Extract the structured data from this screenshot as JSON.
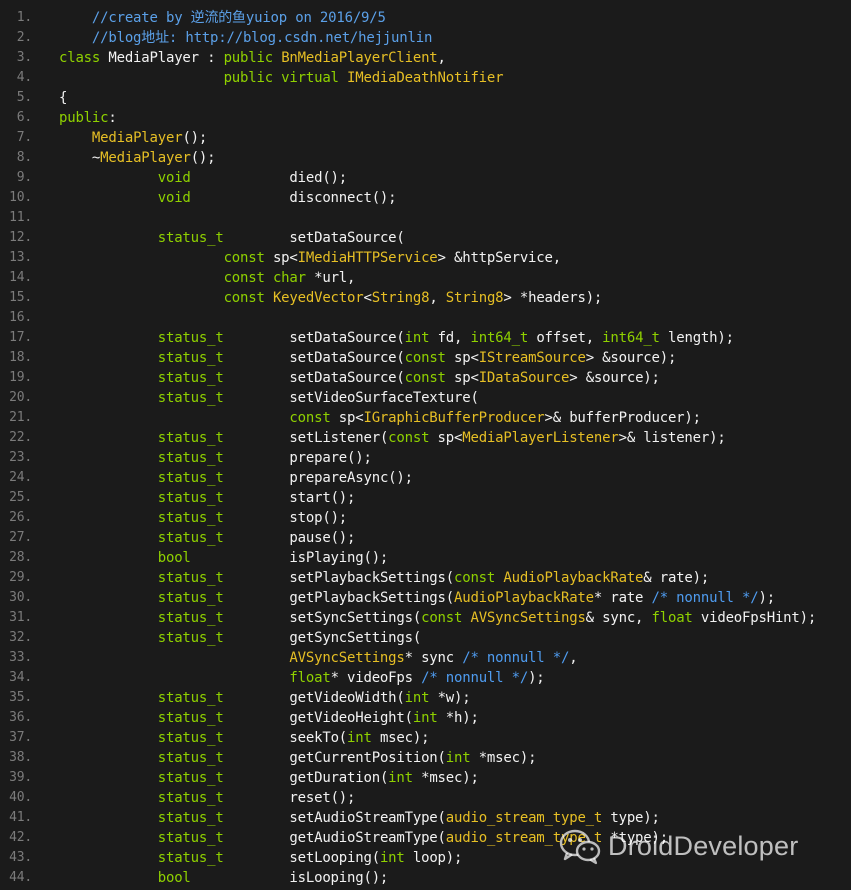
{
  "editor": {
    "lines": [
      {
        "n": "1.",
        "tokens": [
          [
            "c",
            "    //create by 逆流的鱼yuiop on 2016/9/5"
          ]
        ]
      },
      {
        "n": "2.",
        "tokens": [
          [
            "c",
            "    //blog地址: http://blog.csdn.net/hejjunlin"
          ]
        ]
      },
      {
        "n": "3.",
        "tokens": [
          [
            "k",
            "class "
          ],
          [
            "p",
            "MediaPlayer : "
          ],
          [
            "k",
            "public "
          ],
          [
            "y",
            "BnMediaPlayerClient"
          ],
          [
            "p",
            ","
          ]
        ]
      },
      {
        "n": "4.",
        "tokens": [
          [
            "p",
            "                    "
          ],
          [
            "k",
            "public virtual "
          ],
          [
            "y",
            "IMediaDeathNotifier"
          ]
        ]
      },
      {
        "n": "5.",
        "tokens": [
          [
            "p",
            "{"
          ]
        ]
      },
      {
        "n": "6.",
        "tokens": [
          [
            "k",
            "public"
          ],
          [
            "p",
            ":"
          ]
        ]
      },
      {
        "n": "7.",
        "tokens": [
          [
            "p",
            "    "
          ],
          [
            "y",
            "MediaPlayer"
          ],
          [
            "p",
            "();"
          ]
        ]
      },
      {
        "n": "8.",
        "tokens": [
          [
            "p",
            "    ~"
          ],
          [
            "y",
            "MediaPlayer"
          ],
          [
            "p",
            "();"
          ]
        ]
      },
      {
        "n": "9.",
        "tokens": [
          [
            "p",
            "            "
          ],
          [
            "k",
            "void"
          ],
          [
            "p",
            "            died();"
          ]
        ]
      },
      {
        "n": "10.",
        "tokens": [
          [
            "p",
            "            "
          ],
          [
            "k",
            "void"
          ],
          [
            "p",
            "            disconnect();"
          ]
        ]
      },
      {
        "n": "11.",
        "tokens": [
          [
            "p",
            ""
          ]
        ]
      },
      {
        "n": "12.",
        "tokens": [
          [
            "p",
            "            "
          ],
          [
            "k",
            "status_t"
          ],
          [
            "p",
            "        setDataSource("
          ]
        ]
      },
      {
        "n": "13.",
        "tokens": [
          [
            "p",
            "                    "
          ],
          [
            "k",
            "const "
          ],
          [
            "p",
            "sp<"
          ],
          [
            "y",
            "IMediaHTTPService"
          ],
          [
            "p",
            "> &httpService,"
          ]
        ]
      },
      {
        "n": "14.",
        "tokens": [
          [
            "p",
            "                    "
          ],
          [
            "k",
            "const char "
          ],
          [
            "p",
            "*url,"
          ]
        ]
      },
      {
        "n": "15.",
        "tokens": [
          [
            "p",
            "                    "
          ],
          [
            "k",
            "const "
          ],
          [
            "y",
            "KeyedVector"
          ],
          [
            "p",
            "<"
          ],
          [
            "y",
            "String8"
          ],
          [
            "p",
            ", "
          ],
          [
            "y",
            "String8"
          ],
          [
            "p",
            "> *headers);"
          ]
        ]
      },
      {
        "n": "16.",
        "tokens": [
          [
            "p",
            ""
          ]
        ]
      },
      {
        "n": "17.",
        "tokens": [
          [
            "p",
            "            "
          ],
          [
            "k",
            "status_t"
          ],
          [
            "p",
            "        setDataSource("
          ],
          [
            "k",
            "int "
          ],
          [
            "p",
            "fd, "
          ],
          [
            "k",
            "int64_t "
          ],
          [
            "p",
            "offset, "
          ],
          [
            "k",
            "int64_t "
          ],
          [
            "p",
            "length);"
          ]
        ]
      },
      {
        "n": "18.",
        "tokens": [
          [
            "p",
            "            "
          ],
          [
            "k",
            "status_t"
          ],
          [
            "p",
            "        setDataSource("
          ],
          [
            "k",
            "const "
          ],
          [
            "p",
            "sp<"
          ],
          [
            "y",
            "IStreamSource"
          ],
          [
            "p",
            "> &source);"
          ]
        ]
      },
      {
        "n": "19.",
        "tokens": [
          [
            "p",
            "            "
          ],
          [
            "k",
            "status_t"
          ],
          [
            "p",
            "        setDataSource("
          ],
          [
            "k",
            "const "
          ],
          [
            "p",
            "sp<"
          ],
          [
            "y",
            "IDataSource"
          ],
          [
            "p",
            "> &source);"
          ]
        ]
      },
      {
        "n": "20.",
        "tokens": [
          [
            "p",
            "            "
          ],
          [
            "k",
            "status_t"
          ],
          [
            "p",
            "        setVideoSurfaceTexture("
          ]
        ]
      },
      {
        "n": "21.",
        "tokens": [
          [
            "p",
            "                            "
          ],
          [
            "k",
            "const "
          ],
          [
            "p",
            "sp<"
          ],
          [
            "y",
            "IGraphicBufferProducer"
          ],
          [
            "p",
            ">& bufferProducer);"
          ]
        ]
      },
      {
        "n": "22.",
        "tokens": [
          [
            "p",
            "            "
          ],
          [
            "k",
            "status_t"
          ],
          [
            "p",
            "        setListener("
          ],
          [
            "k",
            "const "
          ],
          [
            "p",
            "sp<"
          ],
          [
            "y",
            "MediaPlayerListener"
          ],
          [
            "p",
            ">& listener);"
          ]
        ]
      },
      {
        "n": "23.",
        "tokens": [
          [
            "p",
            "            "
          ],
          [
            "k",
            "status_t"
          ],
          [
            "p",
            "        prepare();"
          ]
        ]
      },
      {
        "n": "24.",
        "tokens": [
          [
            "p",
            "            "
          ],
          [
            "k",
            "status_t"
          ],
          [
            "p",
            "        prepareAsync();"
          ]
        ]
      },
      {
        "n": "25.",
        "tokens": [
          [
            "p",
            "            "
          ],
          [
            "k",
            "status_t"
          ],
          [
            "p",
            "        start();"
          ]
        ]
      },
      {
        "n": "26.",
        "tokens": [
          [
            "p",
            "            "
          ],
          [
            "k",
            "status_t"
          ],
          [
            "p",
            "        stop();"
          ]
        ]
      },
      {
        "n": "27.",
        "tokens": [
          [
            "p",
            "            "
          ],
          [
            "k",
            "status_t"
          ],
          [
            "p",
            "        pause();"
          ]
        ]
      },
      {
        "n": "28.",
        "tokens": [
          [
            "p",
            "            "
          ],
          [
            "k",
            "bool"
          ],
          [
            "p",
            "            isPlaying();"
          ]
        ]
      },
      {
        "n": "29.",
        "tokens": [
          [
            "p",
            "            "
          ],
          [
            "k",
            "status_t"
          ],
          [
            "p",
            "        setPlaybackSettings("
          ],
          [
            "k",
            "const "
          ],
          [
            "y",
            "AudioPlaybackRate"
          ],
          [
            "p",
            "& rate);"
          ]
        ]
      },
      {
        "n": "30.",
        "tokens": [
          [
            "p",
            "            "
          ],
          [
            "k",
            "status_t"
          ],
          [
            "p",
            "        getPlaybackSettings("
          ],
          [
            "y",
            "AudioPlaybackRate"
          ],
          [
            "p",
            "* rate "
          ],
          [
            "cc",
            "/* nonnull */"
          ],
          [
            "p",
            ");"
          ]
        ]
      },
      {
        "n": "31.",
        "tokens": [
          [
            "p",
            "            "
          ],
          [
            "k",
            "status_t"
          ],
          [
            "p",
            "        setSyncSettings("
          ],
          [
            "k",
            "const "
          ],
          [
            "y",
            "AVSyncSettings"
          ],
          [
            "p",
            "& sync, "
          ],
          [
            "k",
            "float "
          ],
          [
            "p",
            "videoFpsHint);"
          ]
        ]
      },
      {
        "n": "32.",
        "tokens": [
          [
            "p",
            "            "
          ],
          [
            "k",
            "status_t"
          ],
          [
            "p",
            "        getSyncSettings("
          ]
        ]
      },
      {
        "n": "33.",
        "tokens": [
          [
            "p",
            "                            "
          ],
          [
            "y",
            "AVSyncSettings"
          ],
          [
            "p",
            "* sync "
          ],
          [
            "cc",
            "/* nonnull */"
          ],
          [
            "p",
            ","
          ]
        ]
      },
      {
        "n": "34.",
        "tokens": [
          [
            "p",
            "                            "
          ],
          [
            "k",
            "float"
          ],
          [
            "p",
            "* videoFps "
          ],
          [
            "cc",
            "/* nonnull */"
          ],
          [
            "p",
            ");"
          ]
        ]
      },
      {
        "n": "35.",
        "tokens": [
          [
            "p",
            "            "
          ],
          [
            "k",
            "status_t"
          ],
          [
            "p",
            "        getVideoWidth("
          ],
          [
            "k",
            "int "
          ],
          [
            "p",
            "*w);"
          ]
        ]
      },
      {
        "n": "36.",
        "tokens": [
          [
            "p",
            "            "
          ],
          [
            "k",
            "status_t"
          ],
          [
            "p",
            "        getVideoHeight("
          ],
          [
            "k",
            "int "
          ],
          [
            "p",
            "*h);"
          ]
        ]
      },
      {
        "n": "37.",
        "tokens": [
          [
            "p",
            "            "
          ],
          [
            "k",
            "status_t"
          ],
          [
            "p",
            "        seekTo("
          ],
          [
            "k",
            "int "
          ],
          [
            "p",
            "msec);"
          ]
        ]
      },
      {
        "n": "38.",
        "tokens": [
          [
            "p",
            "            "
          ],
          [
            "k",
            "status_t"
          ],
          [
            "p",
            "        getCurrentPosition("
          ],
          [
            "k",
            "int "
          ],
          [
            "p",
            "*msec);"
          ]
        ]
      },
      {
        "n": "39.",
        "tokens": [
          [
            "p",
            "            "
          ],
          [
            "k",
            "status_t"
          ],
          [
            "p",
            "        getDuration("
          ],
          [
            "k",
            "int "
          ],
          [
            "p",
            "*msec);"
          ]
        ]
      },
      {
        "n": "40.",
        "tokens": [
          [
            "p",
            "            "
          ],
          [
            "k",
            "status_t"
          ],
          [
            "p",
            "        reset();"
          ]
        ]
      },
      {
        "n": "41.",
        "tokens": [
          [
            "p",
            "            "
          ],
          [
            "k",
            "status_t"
          ],
          [
            "p",
            "        setAudioStreamType("
          ],
          [
            "y",
            "audio_stream_type_t "
          ],
          [
            "p",
            "type);"
          ]
        ]
      },
      {
        "n": "42.",
        "tokens": [
          [
            "p",
            "            "
          ],
          [
            "k",
            "status_t"
          ],
          [
            "p",
            "        getAudioStreamType("
          ],
          [
            "y",
            "audio_stream_type_t "
          ],
          [
            "p",
            "*type);"
          ]
        ]
      },
      {
        "n": "43.",
        "tokens": [
          [
            "p",
            "            "
          ],
          [
            "k",
            "status_t"
          ],
          [
            "p",
            "        setLooping("
          ],
          [
            "k",
            "int "
          ],
          [
            "p",
            "loop);"
          ]
        ]
      },
      {
        "n": "44.",
        "tokens": [
          [
            "p",
            "            "
          ],
          [
            "k",
            "bool"
          ],
          [
            "p",
            "            isLooping();"
          ]
        ]
      }
    ]
  },
  "watermark": {
    "text": "DroidDeveloper",
    "icon": "wechat-icon"
  },
  "colors": {
    "background": "#1b1b1b",
    "comment": "#5ba0e8",
    "keyword": "#8fd100",
    "class_name": "#e6bf25",
    "plain": "#f2f2f2",
    "line_number": "#7b7b7b"
  }
}
